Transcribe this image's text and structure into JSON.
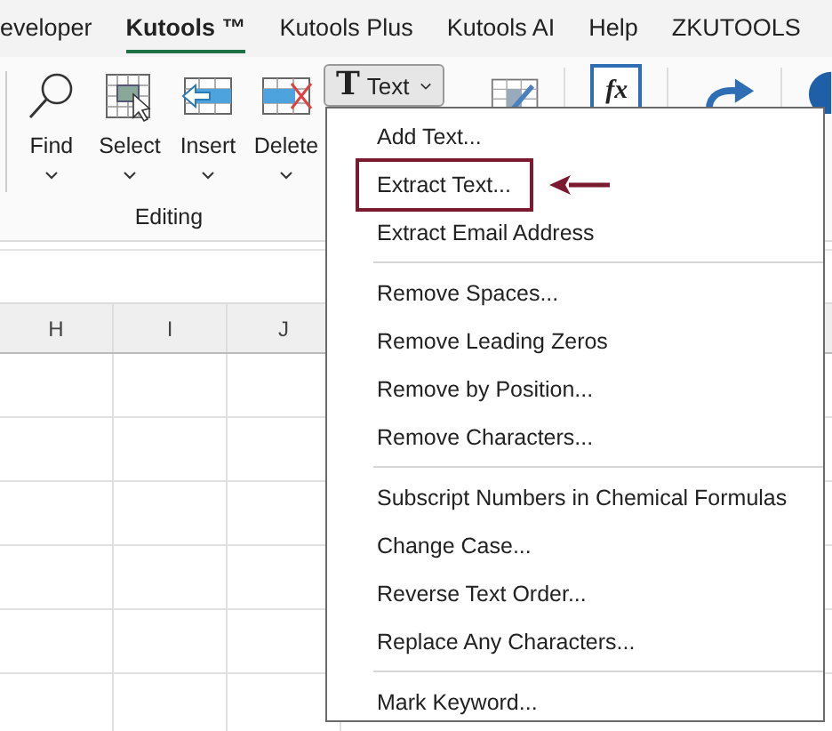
{
  "tabs": [
    {
      "label": "eveloper",
      "selected": false
    },
    {
      "label": "Kutools ™",
      "selected": true
    },
    {
      "label": "Kutools Plus",
      "selected": false
    },
    {
      "label": "Kutools AI",
      "selected": false
    },
    {
      "label": "Help",
      "selected": false
    },
    {
      "label": "ZKUTOOLS",
      "selected": false
    }
  ],
  "ribbon": {
    "tools": [
      {
        "label": "Find",
        "kind": "find"
      },
      {
        "label": "Select",
        "kind": "select"
      },
      {
        "label": "Insert",
        "kind": "insert"
      },
      {
        "label": "Delete",
        "kind": "delete"
      }
    ],
    "group_label": "Editing",
    "text_button": {
      "glyph": "T",
      "label": "Text",
      "expanded": true
    },
    "formula_glyph": "fx"
  },
  "columns": [
    "H",
    "I",
    "J"
  ],
  "menu": {
    "sections": [
      {
        "items": [
          {
            "label": "Add Text...",
            "selected": false
          },
          {
            "label": "Extract Text...",
            "selected": true
          },
          {
            "label": "Extract Email Address",
            "selected": false
          }
        ]
      },
      {
        "items": [
          {
            "label": "Remove Spaces...",
            "selected": false
          },
          {
            "label": "Remove Leading Zeros",
            "selected": false
          },
          {
            "label": "Remove by Position...",
            "selected": false
          },
          {
            "label": "Remove Characters...",
            "selected": false
          }
        ]
      },
      {
        "items": [
          {
            "label": "Subscript Numbers in Chemical Formulas",
            "selected": false
          },
          {
            "label": "Change Case...",
            "selected": false
          },
          {
            "label": "Reverse Text Order...",
            "selected": false
          },
          {
            "label": "Replace Any Characters...",
            "selected": false
          }
        ]
      },
      {
        "items": [
          {
            "label": "Mark Keyword...",
            "selected": false
          }
        ]
      }
    ]
  }
}
